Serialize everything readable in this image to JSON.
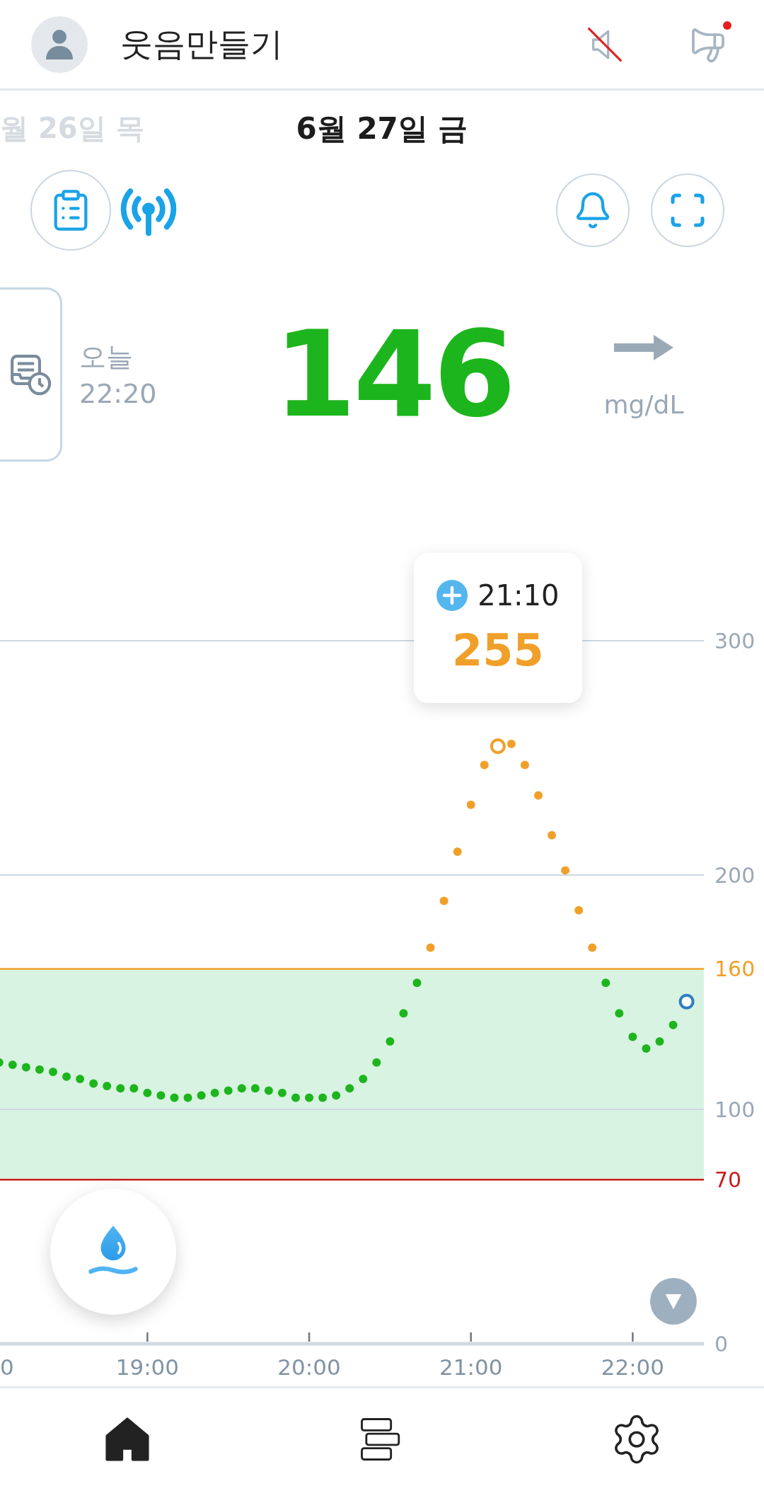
{
  "header": {
    "title": "웃음만들기",
    "sound_muted": true,
    "notice_unread": true
  },
  "date_nav": {
    "previous": "월 26일 목",
    "current": "6월 27일 금"
  },
  "reading": {
    "day": "오늘",
    "time": "22:20",
    "value": "146",
    "unit": "mg/dL"
  },
  "chart": {
    "tooltip": {
      "time": "21:10",
      "value": "255"
    },
    "cut_tick_label": "0",
    "chart_data": {
      "type": "scatter",
      "xlim": [
        18.08,
        22.44
      ],
      "ylim": [
        0,
        300
      ],
      "grid": "y",
      "xticks": [
        {
          "value": 19,
          "label": "19:00"
        },
        {
          "value": 20,
          "label": "20:00"
        },
        {
          "value": 21,
          "label": "21:00"
        },
        {
          "value": 22,
          "label": "22:00"
        }
      ],
      "yticks": [
        0,
        70,
        100,
        160,
        200,
        300
      ],
      "ref_lines": [
        {
          "axis": "y",
          "value": 160,
          "color": "#f0a02a"
        },
        {
          "axis": "y",
          "value": 70,
          "color": "#c81e1e"
        }
      ],
      "bands": [
        {
          "axis": "y",
          "from": 70,
          "to": 160,
          "color": "#d8f3e1"
        }
      ],
      "x": [
        18.0833,
        18.1667,
        18.25,
        18.3333,
        18.4167,
        18.5,
        18.5833,
        18.6667,
        18.75,
        18.8333,
        18.9167,
        19,
        19.0833,
        19.1667,
        19.25,
        19.3333,
        19.4167,
        19.5,
        19.5833,
        19.6667,
        19.75,
        19.8333,
        19.9167,
        20,
        20.0833,
        20.1667,
        20.25,
        20.3333,
        20.4167,
        20.5,
        20.5833,
        20.6667,
        20.75,
        20.8333,
        20.9167,
        21,
        21.0833,
        21.1667,
        21.25,
        21.3333,
        21.4167,
        21.5,
        21.5833,
        21.6667,
        21.75,
        21.8333,
        21.9167,
        22,
        22.0833,
        22.1667,
        22.25,
        22.3333
      ],
      "series": [
        {
          "color": "#1db51d",
          "marker": "circle",
          "values": [
            120,
            119,
            118,
            117,
            116,
            114,
            113,
            111,
            110,
            109,
            109,
            107,
            106,
            105,
            105,
            106,
            107,
            108,
            109,
            109,
            108,
            107,
            105,
            105,
            105,
            106,
            109,
            113,
            120,
            129,
            141,
            154,
            null,
            null,
            null,
            null,
            null,
            null,
            null,
            null,
            null,
            null,
            null,
            null,
            null,
            154,
            141,
            131,
            126,
            129,
            136,
            null
          ]
        },
        {
          "color": "#f0a02a",
          "marker": "circle",
          "values": [
            null,
            null,
            null,
            null,
            null,
            null,
            null,
            null,
            null,
            null,
            null,
            null,
            null,
            null,
            null,
            null,
            null,
            null,
            null,
            null,
            null,
            null,
            null,
            null,
            null,
            null,
            null,
            null,
            null,
            null,
            null,
            null,
            169,
            189,
            210,
            230,
            247,
            null,
            256,
            247,
            234,
            217,
            202,
            185,
            169,
            null,
            null,
            null,
            null,
            null,
            null,
            null
          ]
        },
        {
          "color": "#f0a02a",
          "values": [
            null,
            null,
            null,
            null,
            null,
            null,
            null,
            null,
            null,
            null,
            null,
            null,
            null,
            null,
            null,
            null,
            null,
            null,
            null,
            null,
            null,
            null,
            null,
            null,
            null,
            null,
            null,
            null,
            null,
            null,
            null,
            null,
            null,
            null,
            null,
            null,
            null,
            255,
            null,
            null,
            null,
            null,
            null,
            null,
            null,
            null,
            null,
            null,
            null,
            null,
            null,
            null
          ]
        },
        {
          "color": "#2f7fc1",
          "values": [
            null,
            null,
            null,
            null,
            null,
            null,
            null,
            null,
            null,
            null,
            null,
            null,
            null,
            null,
            null,
            null,
            null,
            null,
            null,
            null,
            null,
            null,
            null,
            null,
            null,
            null,
            null,
            null,
            null,
            null,
            null,
            null,
            null,
            null,
            null,
            null,
            null,
            null,
            null,
            null,
            null,
            null,
            null,
            null,
            null,
            null,
            null,
            null,
            null,
            null,
            null,
            146
          ]
        }
      ]
    }
  },
  "bottom_nav": [
    {
      "kind": "home",
      "selected": true
    },
    {
      "kind": "records",
      "selected": false
    },
    {
      "kind": "settings",
      "selected": false
    }
  ]
}
